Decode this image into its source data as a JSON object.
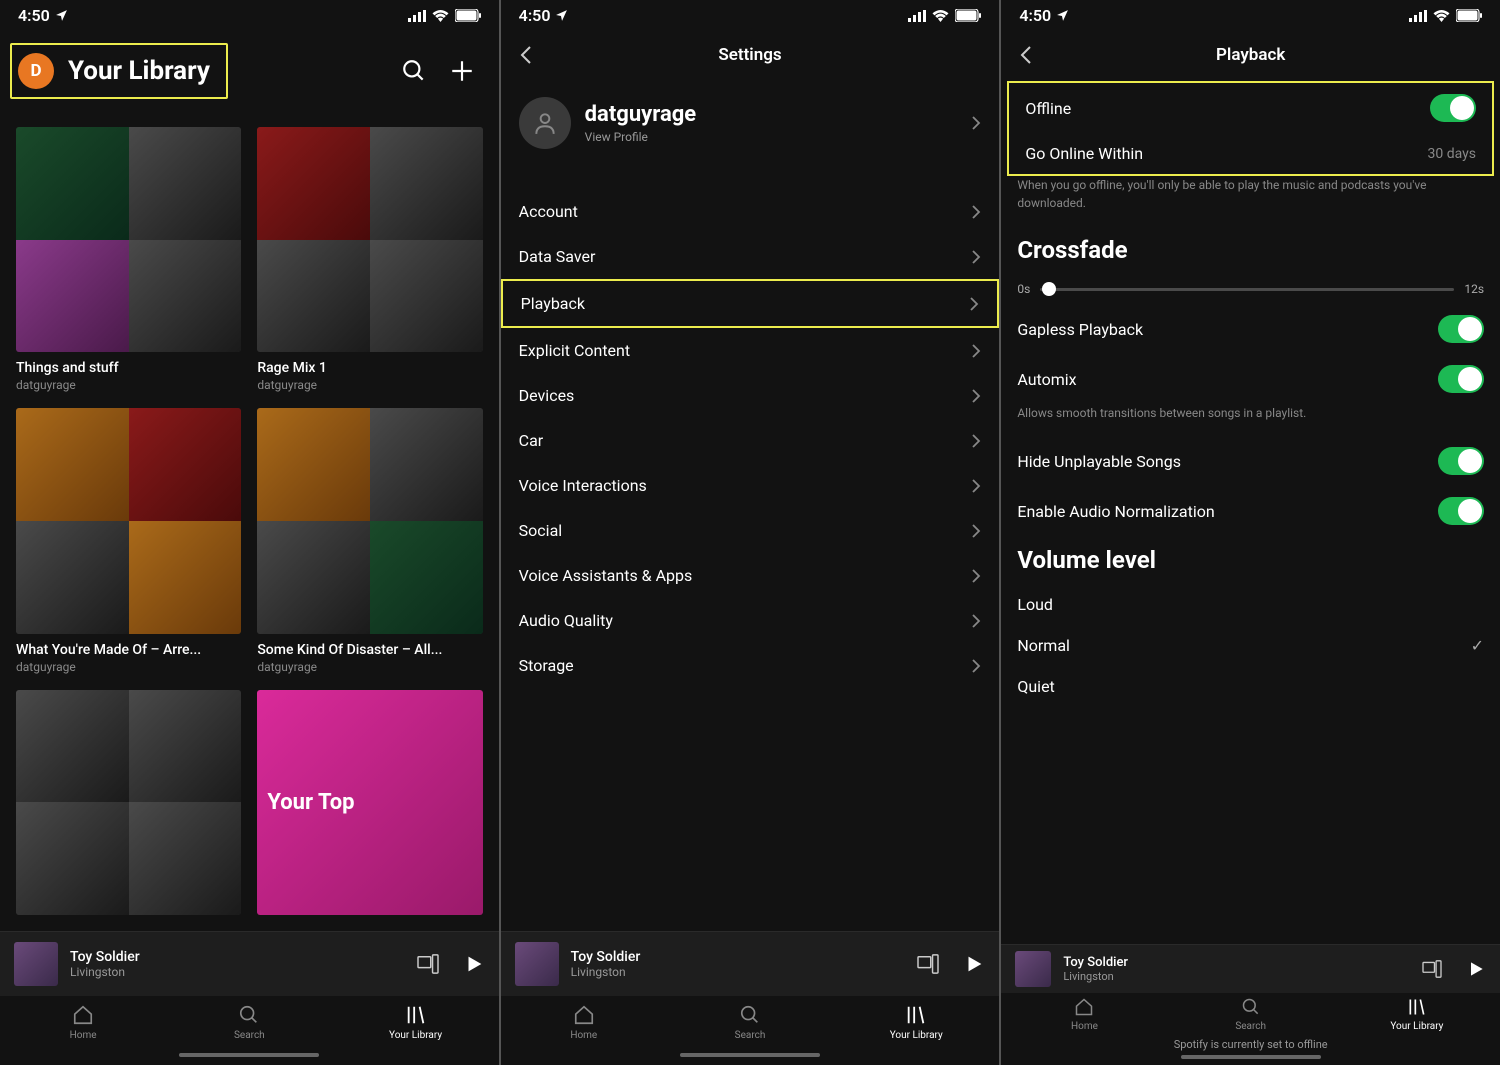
{
  "status": {
    "time": "4:50"
  },
  "screens": {
    "library": {
      "avatar_letter": "D",
      "title": "Your Library",
      "items": [
        {
          "title": "Things and stuff",
          "subtitle": "datguyrage"
        },
        {
          "title": "Rage Mix 1",
          "subtitle": "datguyrage"
        },
        {
          "title": "What You're Made Of – Arre...",
          "subtitle": "datguyrage"
        },
        {
          "title": "Some Kind Of Disaster – All...",
          "subtitle": "datguyrage"
        },
        {
          "title": "",
          "subtitle": ""
        },
        {
          "title": "Your Top",
          "subtitle": ""
        }
      ]
    },
    "settings": {
      "title": "Settings",
      "profile_name": "datguyrage",
      "profile_sub": "View Profile",
      "rows": [
        "Account",
        "Data Saver",
        "Playback",
        "Explicit Content",
        "Devices",
        "Car",
        "Voice Interactions",
        "Social",
        "Voice Assistants & Apps",
        "Audio Quality",
        "Storage"
      ]
    },
    "playback": {
      "title": "Playback",
      "offline_label": "Offline",
      "go_online_label": "Go Online Within",
      "go_online_value": "30 days",
      "help_text": "When you go offline, you'll only be able to play the music and podcasts you've downloaded.",
      "crossfade_title": "Crossfade",
      "crossfade_min": "0s",
      "crossfade_max": "12s",
      "toggles": [
        {
          "label": "Gapless Playback"
        },
        {
          "label": "Automix"
        }
      ],
      "automix_help": "Allows smooth transitions between songs in a playlist.",
      "toggles2": [
        {
          "label": "Hide Unplayable Songs"
        },
        {
          "label": "Enable Audio Normalization"
        }
      ],
      "volume_title": "Volume level",
      "volume_options": [
        "Loud",
        "Normal",
        "Quiet"
      ],
      "offline_msg": "Spotify is currently set to offline"
    }
  },
  "now_playing": {
    "title": "Toy Soldier",
    "artist": "Livingston"
  },
  "tabs": {
    "home": "Home",
    "search": "Search",
    "library": "Your Library"
  }
}
